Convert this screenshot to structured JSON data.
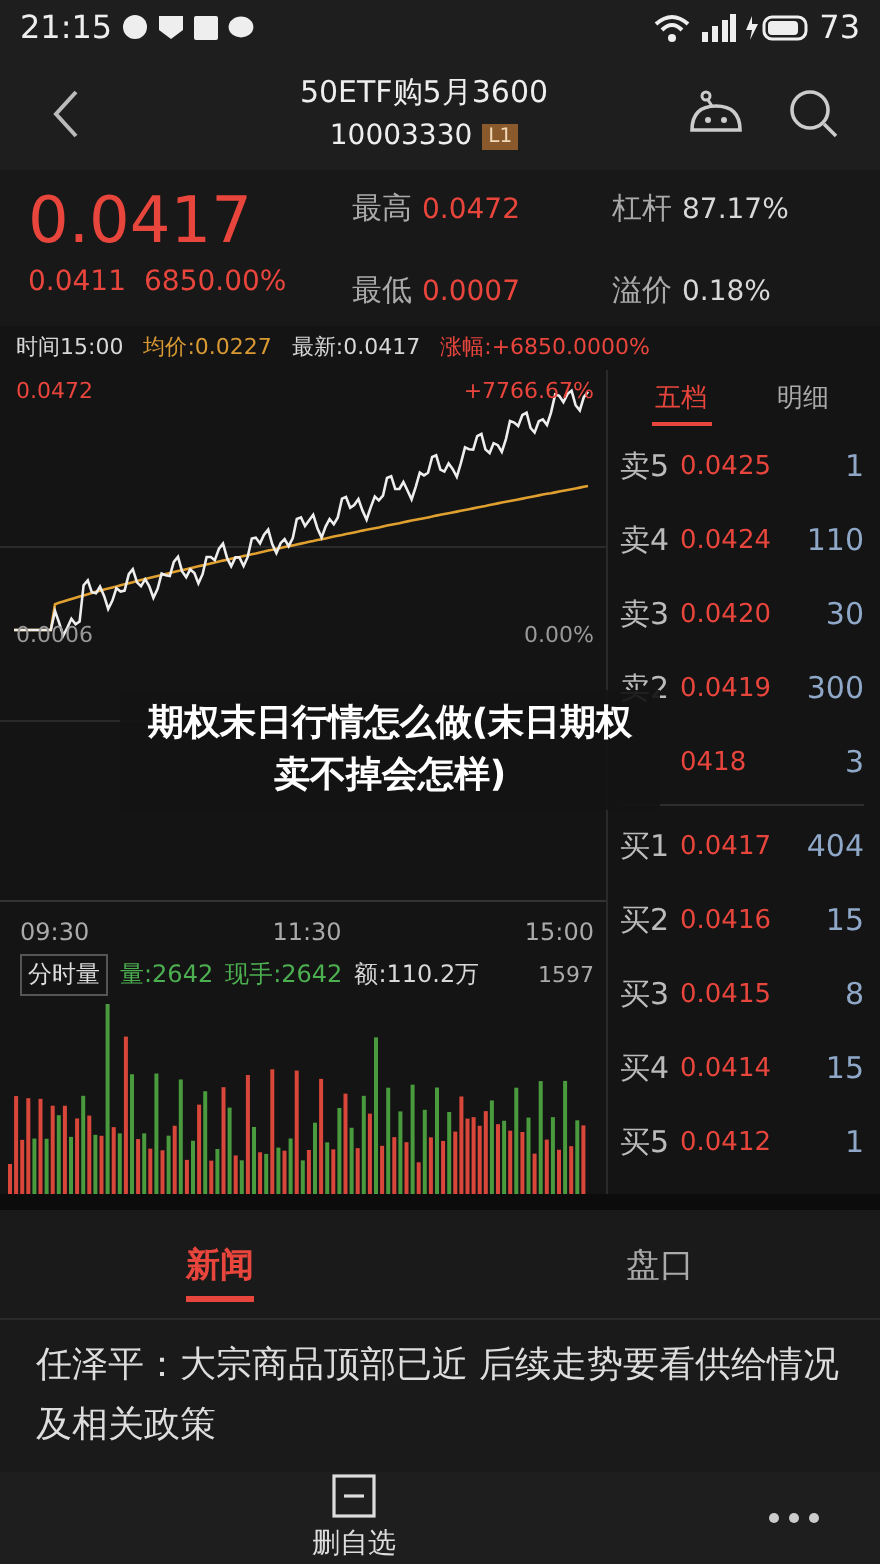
{
  "status_bar": {
    "time": "21:15",
    "battery": "73"
  },
  "header": {
    "title": "50ETF购5月3600",
    "code": "10003330",
    "badge": "L1"
  },
  "quote": {
    "price": "0.0417",
    "change": "0.0411",
    "change_pct": "6850.00%",
    "stats": [
      {
        "label": "最高",
        "value": "0.0472",
        "color": "#e8453c"
      },
      {
        "label": "杠杆",
        "value": "87.17%",
        "color": "#d8d8d8"
      },
      {
        "label": "最低",
        "value": "0.0007",
        "color": "#e8453c"
      },
      {
        "label": "溢价",
        "value": "0.18%",
        "color": "#d8d8d8"
      }
    ]
  },
  "info_line": [
    {
      "text": "时间15:00",
      "color": "#d8d8d8"
    },
    {
      "text": "均价:0.0227",
      "color": "#d99a34"
    },
    {
      "text": "最新:0.0417",
      "color": "#d8d8d8"
    },
    {
      "text": "涨幅:+6850.0000%",
      "color": "#e8453c"
    }
  ],
  "chart": {
    "high_label": "0.0472",
    "high_pct": "+7766.67%",
    "base_label": "0.0006",
    "base_pct": "0.00%",
    "times": [
      "09:30",
      "11:30",
      "15:00"
    ],
    "volume_tab": "分时量",
    "volume_stats": [
      {
        "text": "量:2642",
        "color": "#4caf50"
      },
      {
        "text": "现手:2642",
        "color": "#4caf50"
      },
      {
        "text": "额:110.2万",
        "color": "#d8d8d8"
      }
    ],
    "volume_max": "1597"
  },
  "order_book": {
    "tabs": [
      {
        "label": "五档",
        "selected": true
      },
      {
        "label": "明细",
        "selected": false
      }
    ],
    "asks": [
      {
        "label": "卖5",
        "price": "0.0425",
        "volume": "1"
      },
      {
        "label": "卖4",
        "price": "0.0424",
        "volume": "110"
      },
      {
        "label": "卖3",
        "price": "0.0420",
        "volume": "30"
      },
      {
        "label": "卖2",
        "price": "0.0419",
        "volume": "300"
      },
      {
        "price": "0418",
        "volume": "3"
      }
    ],
    "bids": [
      {
        "label": "买1",
        "price": "0.0417",
        "volume": "404"
      },
      {
        "label": "买2",
        "price": "0.0416",
        "volume": "15"
      },
      {
        "label": "买3",
        "price": "0.0415",
        "volume": "8"
      },
      {
        "label": "买4",
        "price": "0.0414",
        "volume": "15"
      },
      {
        "label": "买5",
        "price": "0.0412",
        "volume": "1"
      }
    ]
  },
  "caption": "期权末日行情怎么做(末日期权卖不掉会怎样)",
  "bottom_tabs": [
    {
      "label": "新闻",
      "selected": true
    },
    {
      "label": "盘口",
      "selected": false
    }
  ],
  "news": "任泽平：大宗商品顶部已近 后续走势要看供给情况及相关政策",
  "action_bar": {
    "label": "删自选"
  }
}
